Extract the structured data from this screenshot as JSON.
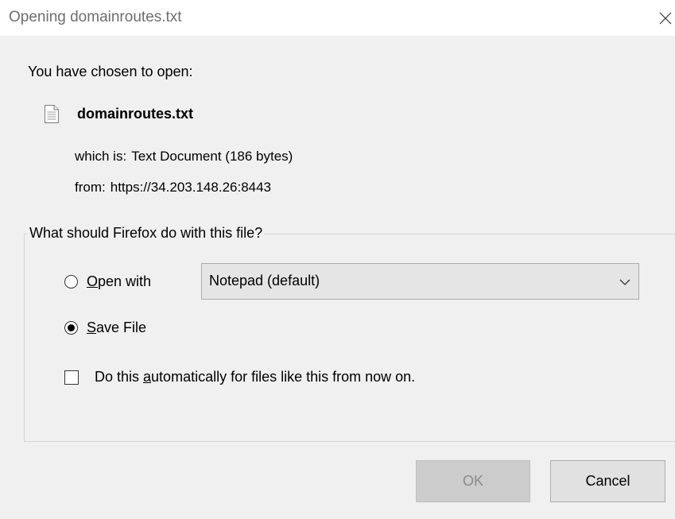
{
  "window": {
    "title": "Opening domainroutes.txt"
  },
  "intro_text": "You have chosen to open:",
  "file": {
    "name": "domainroutes.txt",
    "icon": "text-file-icon",
    "type_label": "which is:",
    "type_value": "Text Document (186 bytes)",
    "from_label": "from:",
    "from_value": "https://34.203.148.26:8443"
  },
  "action_group": {
    "legend": "What should Firefox do with this file?",
    "open_with": {
      "label_mnemonic": "O",
      "label_rest": "pen with",
      "selected": false
    },
    "app_select": {
      "value": "Notepad (default)"
    },
    "save_file": {
      "label_mnemonic": "S",
      "label_rest": "ave File",
      "selected": true
    },
    "auto_checkbox": {
      "label_before": "Do this ",
      "label_mnemonic": "a",
      "label_after": "utomatically for files like this from now on.",
      "checked": false
    }
  },
  "buttons": {
    "ok_label": "OK",
    "ok_enabled": false,
    "cancel_label": "Cancel"
  },
  "colors": {
    "title_text": "#6e6e6e",
    "dialog_bg": "#f0f0f0",
    "titlebar_bg": "#ffffff",
    "disabled_button_bg": "#cccccc"
  }
}
